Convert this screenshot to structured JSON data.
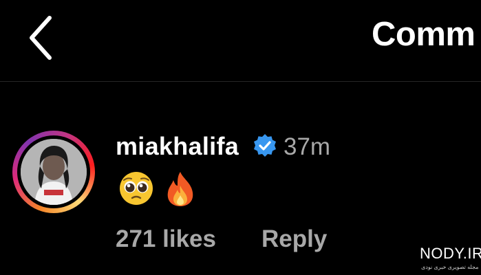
{
  "header": {
    "title": "Comm"
  },
  "comment": {
    "username": "miakhalifa",
    "verified": true,
    "time": "37m",
    "emojis": [
      "pleading-face",
      "fire"
    ],
    "likes": "271 likes",
    "reply_label": "Reply"
  },
  "watermark": {
    "text": "NODY.IR",
    "subtext": "مجله تصویری خبری نودی"
  },
  "colors": {
    "background": "#000000",
    "text_primary": "#ffffff",
    "text_secondary": "#a8a8a8",
    "verified_blue": "#3897f0"
  }
}
